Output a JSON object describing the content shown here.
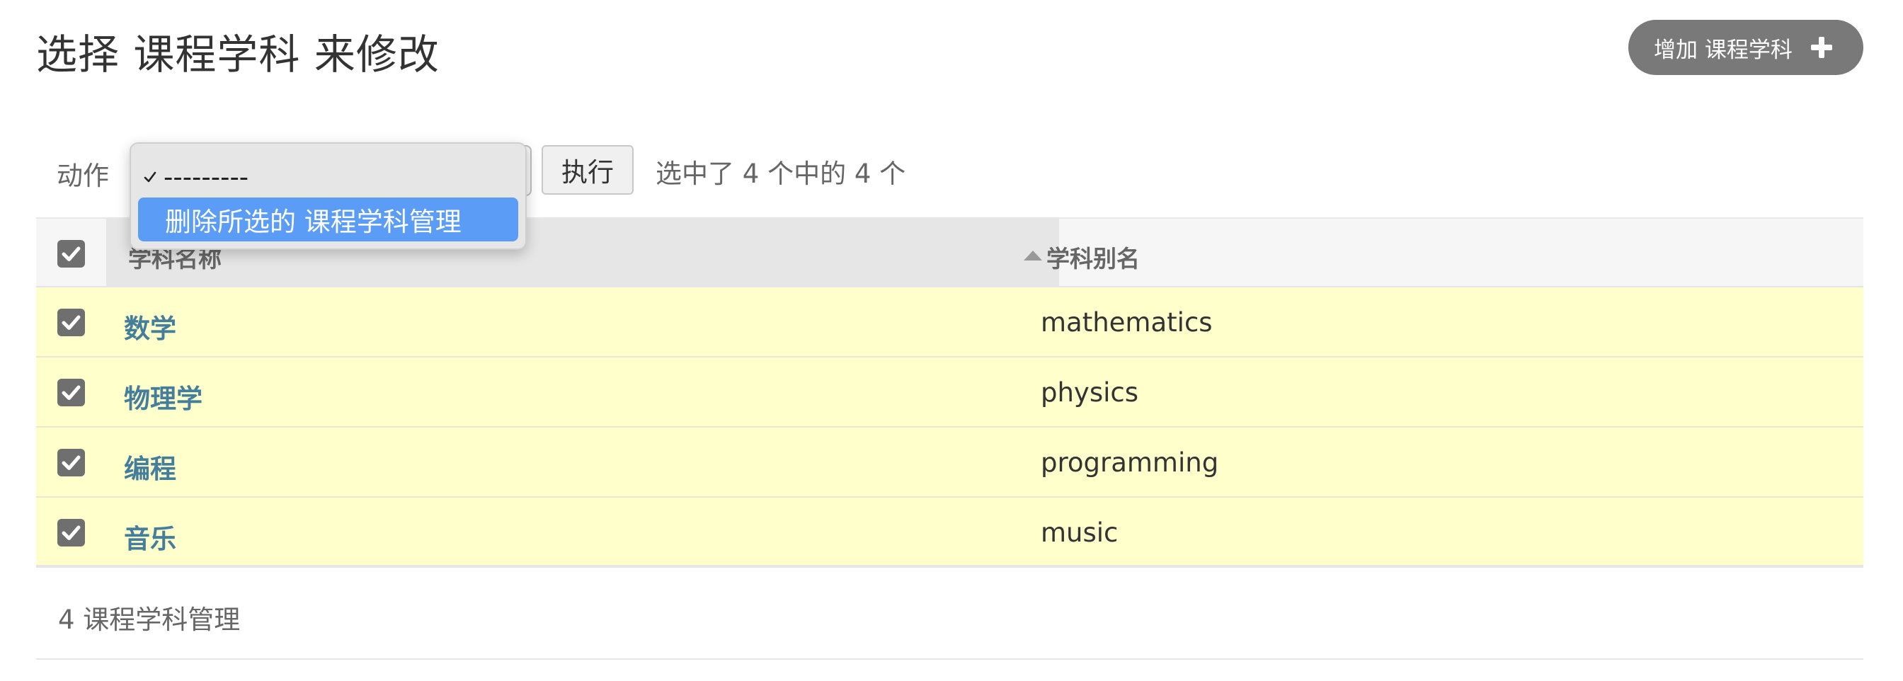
{
  "header": {
    "title": "选择 课程学科 来修改",
    "add_button_label": "增加 课程学科"
  },
  "actions": {
    "label": "动作",
    "select": {
      "options": [
        "---------",
        "删除所选的 课程学科管理"
      ],
      "current": "---------",
      "highlighted": "删除所选的 课程学科管理"
    },
    "run_button_label": "执行",
    "selection_counter": "选中了 4 个中的 4 个"
  },
  "table": {
    "columns": [
      "学科名称",
      "学科别名"
    ],
    "sort": "ascending",
    "rows": [
      {
        "name": "数学",
        "alias": "mathematics",
        "selected": true
      },
      {
        "name": "物理学",
        "alias": "physics",
        "selected": true
      },
      {
        "name": "编程",
        "alias": "programming",
        "selected": true
      },
      {
        "name": "音乐",
        "alias": "music",
        "selected": true
      }
    ]
  },
  "footer": {
    "counter": "4 课程学科管理"
  },
  "colors": {
    "selected_row_bg": "#ffffcc",
    "link": "#447e9b",
    "add_button_bg": "#797979",
    "dropdown_highlight": "#5b9cf6"
  }
}
